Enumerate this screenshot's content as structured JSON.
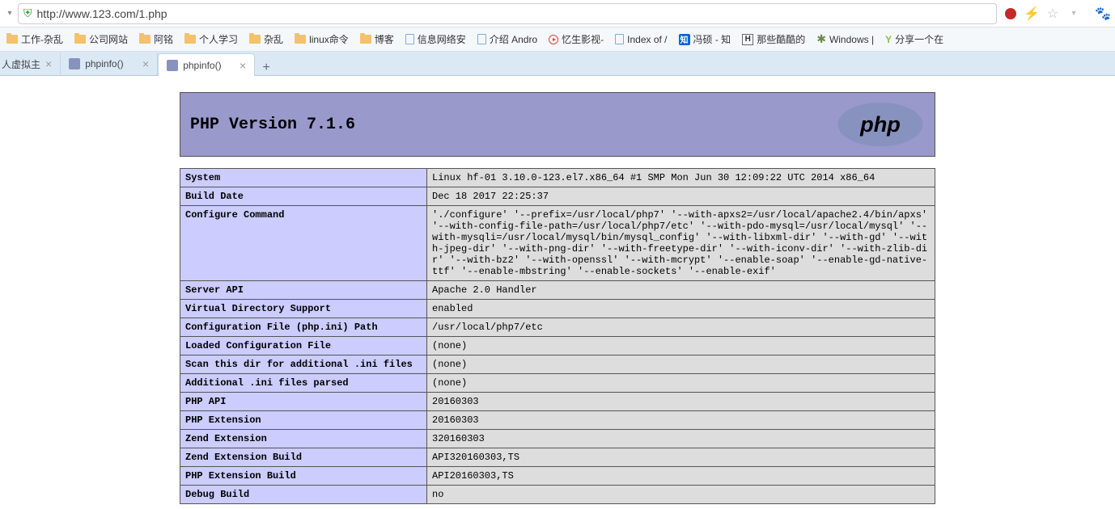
{
  "addressbar": {
    "url": "http://www.123.com/1.php"
  },
  "bookmarks": [
    {
      "label": "工作-杂乱",
      "icon": "folder"
    },
    {
      "label": "公司网站",
      "icon": "folder"
    },
    {
      "label": "阿铭",
      "icon": "folder"
    },
    {
      "label": "个人学习",
      "icon": "folder"
    },
    {
      "label": "杂乱",
      "icon": "folder"
    },
    {
      "label": "linux命令",
      "icon": "folder"
    },
    {
      "label": "博客",
      "icon": "folder"
    },
    {
      "label": "信息网络安",
      "icon": "page"
    },
    {
      "label": "介绍 Andro",
      "icon": "page"
    },
    {
      "label": "忆生影视-",
      "icon": "play"
    },
    {
      "label": "Index of /",
      "icon": "page"
    },
    {
      "label": "冯硕 - 知",
      "icon": "zhi"
    },
    {
      "label": "那些酷酷的",
      "icon": "h"
    },
    {
      "label": "Windows |",
      "icon": "gear"
    },
    {
      "label": "分享一个在",
      "icon": "y"
    }
  ],
  "tabs": [
    {
      "title": "人虚拟主",
      "icon": "bug",
      "active": false,
      "partial": true
    },
    {
      "title": "phpinfo()",
      "icon": "php",
      "active": false
    },
    {
      "title": "phpinfo()",
      "icon": "php",
      "active": true
    }
  ],
  "phpinfo": {
    "heading": "PHP Version 7.1.6",
    "rows": [
      {
        "k": "System",
        "v": "Linux hf-01 3.10.0-123.el7.x86_64 #1 SMP Mon Jun 30 12:09:22 UTC 2014 x86_64"
      },
      {
        "k": "Build Date",
        "v": "Dec 18 2017 22:25:37"
      },
      {
        "k": "Configure Command",
        "v": "'./configure' '--prefix=/usr/local/php7' '--with-apxs2=/usr/local/apache2.4/bin/apxs' '--with-config-file-path=/usr/local/php7/etc' '--with-pdo-mysql=/usr/local/mysql' '--with-mysqli=/usr/local/mysql/bin/mysql_config' '--with-libxml-dir' '--with-gd' '--with-jpeg-dir' '--with-png-dir' '--with-freetype-dir' '--with-iconv-dir' '--with-zlib-dir' '--with-bz2' '--with-openssl' '--with-mcrypt' '--enable-soap' '--enable-gd-native-ttf' '--enable-mbstring' '--enable-sockets' '--enable-exif'"
      },
      {
        "k": "Server API",
        "v": "Apache 2.0 Handler"
      },
      {
        "k": "Virtual Directory Support",
        "v": "enabled"
      },
      {
        "k": "Configuration File (php.ini) Path",
        "v": "/usr/local/php7/etc"
      },
      {
        "k": "Loaded Configuration File",
        "v": "(none)"
      },
      {
        "k": "Scan this dir for additional .ini files",
        "v": "(none)"
      },
      {
        "k": "Additional .ini files parsed",
        "v": "(none)"
      },
      {
        "k": "PHP API",
        "v": "20160303"
      },
      {
        "k": "PHP Extension",
        "v": "20160303"
      },
      {
        "k": "Zend Extension",
        "v": "320160303"
      },
      {
        "k": "Zend Extension Build",
        "v": "API320160303,TS"
      },
      {
        "k": "PHP Extension Build",
        "v": "API20160303,TS"
      },
      {
        "k": "Debug Build",
        "v": "no"
      }
    ]
  }
}
